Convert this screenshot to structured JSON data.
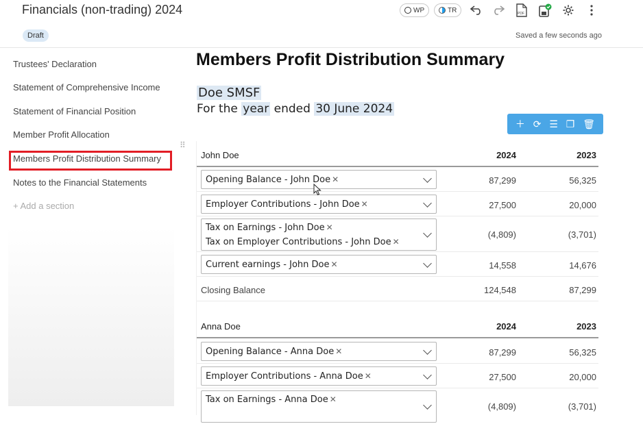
{
  "header": {
    "title": "Financials (non-trading) 2024",
    "wp_label": "WP",
    "tr_label": "TR",
    "icons": [
      "undo-icon",
      "redo-icon",
      "pdf-icon",
      "save-icon",
      "gear-icon",
      "more-vert-icon"
    ]
  },
  "status": {
    "draft": "Draft",
    "saved": "Saved a few seconds ago"
  },
  "sidebar": {
    "items": [
      {
        "label": "Trustees' Declaration"
      },
      {
        "label": "Statement of Comprehensive Income"
      },
      {
        "label": "Statement of Financial Position"
      },
      {
        "label": "Member Profit Allocation"
      },
      {
        "label": "Members Profit Distribution Summary"
      },
      {
        "label": "Notes to the Financial Statements"
      }
    ],
    "add_section": "+ Add a section"
  },
  "document": {
    "title": "Members Profit Distribution Summary",
    "entity": "Doe SMSF",
    "period_prefix": "For the",
    "period_year": "year",
    "period_mid": "ended",
    "period_date": "30 June 2024"
  },
  "table": {
    "year_current": "2024",
    "year_prior": "2023",
    "sections": [
      {
        "member": "John Doe",
        "rows": [
          {
            "chips": [
              "Opening Balance - John Doe"
            ],
            "v2024": "87,299",
            "v2023": "56,325"
          },
          {
            "chips": [
              "Employer Contributions - John Doe"
            ],
            "v2024": "27,500",
            "v2023": "20,000"
          },
          {
            "chips": [
              "Tax on Earnings - John Doe",
              "Tax on Employer Contributions - John Doe"
            ],
            "v2024": "(4,809)",
            "v2023": "(3,701)"
          },
          {
            "chips": [
              "Current earnings - John Doe"
            ],
            "v2024": "14,558",
            "v2023": "14,676"
          }
        ],
        "closing": {
          "label": "Closing Balance",
          "v2024": "124,548",
          "v2023": "87,299"
        }
      },
      {
        "member": "Anna Doe",
        "rows": [
          {
            "chips": [
              "Opening Balance - Anna Doe"
            ],
            "v2024": "87,299",
            "v2023": "56,325"
          },
          {
            "chips": [
              "Employer Contributions - Anna Doe"
            ],
            "v2024": "27,500",
            "v2023": "20,000"
          },
          {
            "chips": [
              "Tax on Earnings - Anna Doe"
            ],
            "v2024": "(4,809)",
            "v2023": "(3,701)"
          }
        ]
      }
    ]
  },
  "colors": {
    "accent": "#4aa6e6",
    "highlight": "#dde8f3",
    "active_outline": "#e21d25"
  }
}
